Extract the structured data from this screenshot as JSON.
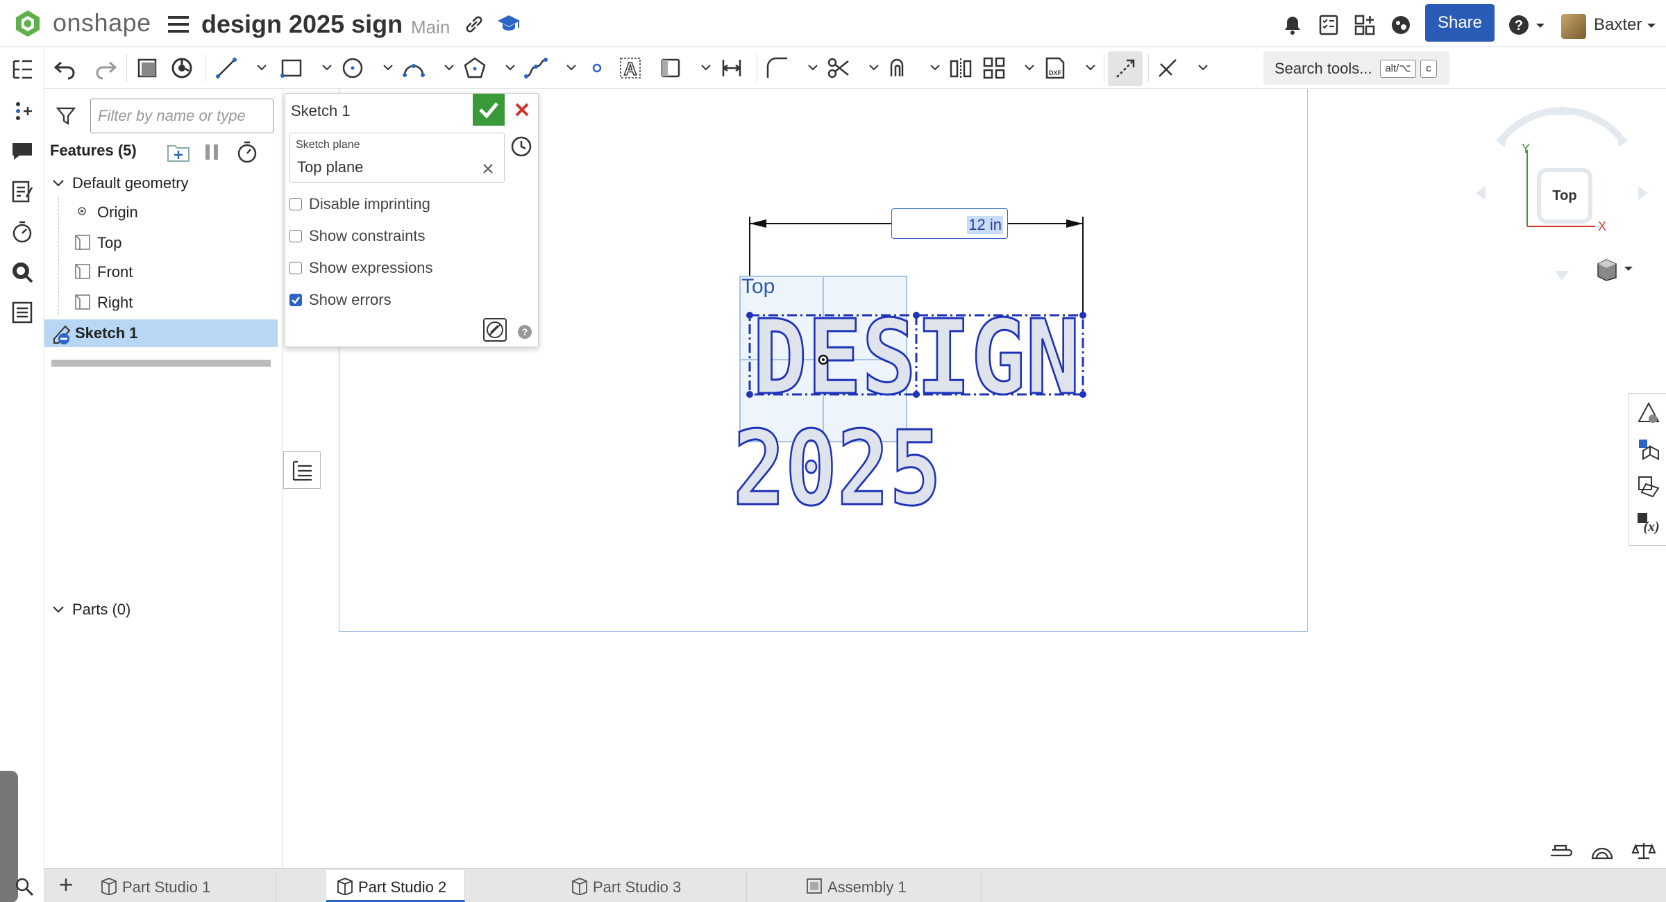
{
  "app": {
    "brand": "onshape",
    "title": "design 2025 sign",
    "branch": "Main"
  },
  "header": {
    "share_label": "Share",
    "user_name": "Baxter"
  },
  "toolbar": {
    "search_label": "Search tools...",
    "shortcut_key1": "alt/⌥",
    "shortcut_key2": "c"
  },
  "feature_panel": {
    "filter_placeholder": "Filter by name or type",
    "features_heading": "Features (5)",
    "default_geometry": "Default geometry",
    "items": [
      "Origin",
      "Top",
      "Front",
      "Right"
    ],
    "sketch_item": "Sketch 1",
    "parts_heading": "Parts (0)"
  },
  "sketch_dialog": {
    "title": "Sketch 1",
    "plane_label": "Sketch plane",
    "plane_value": "Top plane",
    "options": [
      {
        "label": "Disable imprinting",
        "checked": false
      },
      {
        "label": "Show constraints",
        "checked": false
      },
      {
        "label": "Show expressions",
        "checked": false
      },
      {
        "label": "Show errors",
        "checked": true
      }
    ]
  },
  "canvas": {
    "dimension_value": "12 in",
    "plane_label": "Top",
    "sketch_text_line1": "DESIGN",
    "sketch_text_line2": "2025"
  },
  "view_cube": {
    "face": "Top",
    "axis_y": "Y",
    "axis_x": "X"
  },
  "tabs": [
    {
      "label": "Part Studio 1",
      "active": false
    },
    {
      "label": "Part Studio 2",
      "active": true
    },
    {
      "label": "Part Studio 3",
      "active": false
    },
    {
      "label": "Assembly 1",
      "active": false
    }
  ],
  "colors": {
    "accent": "#2a5bb7",
    "sketch": "#1f33b8",
    "confirm": "#3a9a3a",
    "cancel": "#d0342c",
    "selected": "#b7d7f5"
  }
}
